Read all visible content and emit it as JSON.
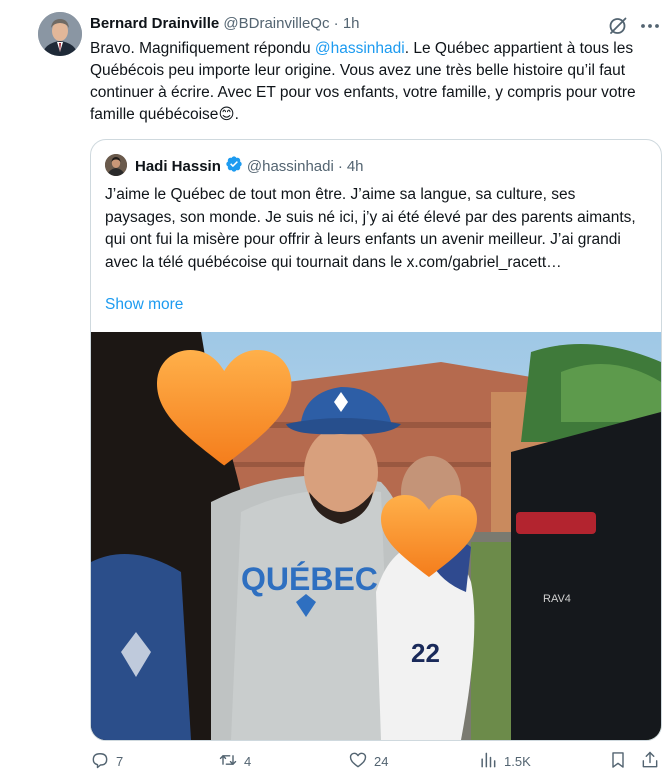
{
  "author": {
    "name": "Bernard Drainville",
    "handle": "@BDrainvilleQc",
    "separator": "·",
    "time": "1h"
  },
  "tweet": {
    "text_1": "Bravo. Magnifiquement répondu ",
    "mention": "@hassinhadi",
    "text_2": ". Le Québec appartient à tous les Québécois peu importe leur origine. Vous avez une très belle histoire qu’il faut continuer à écrire. Avec ET pour vos enfants, votre famille, y compris pour votre famille québécoise",
    "emoji": "😊",
    "text_end": "."
  },
  "quoted": {
    "name": "Hadi Hassin",
    "handle": "@hassinhadi",
    "separator": "·",
    "time": "4h",
    "text": "J’aime le Québec de tout mon être. J’aime sa langue, sa culture, ses paysages, son monde. Je suis né ici, j’y ai été élevé par des parents aimants, qui ont fui la misère pour offrir à leurs enfants un avenir meilleur. J’ai grandi avec la télé québécoise qui tournait dans le x.com/gabriel_racett…",
    "show_more": "Show more",
    "photo": {
      "shirt_text": "QUÉBEC",
      "jersey_number": "22",
      "car_badge": "RAV4"
    }
  },
  "actions": {
    "replies": "7",
    "reposts": "4",
    "likes": "24",
    "views": "1.5K"
  },
  "colors": {
    "accent": "#1d9bf0",
    "secondary_text": "#536471",
    "border": "#cfd9de"
  },
  "icons": [
    "grok-icon",
    "more-icon",
    "verified-badge-icon",
    "reply-icon",
    "repost-icon",
    "like-icon",
    "views-icon",
    "bookmark-icon",
    "share-icon"
  ]
}
